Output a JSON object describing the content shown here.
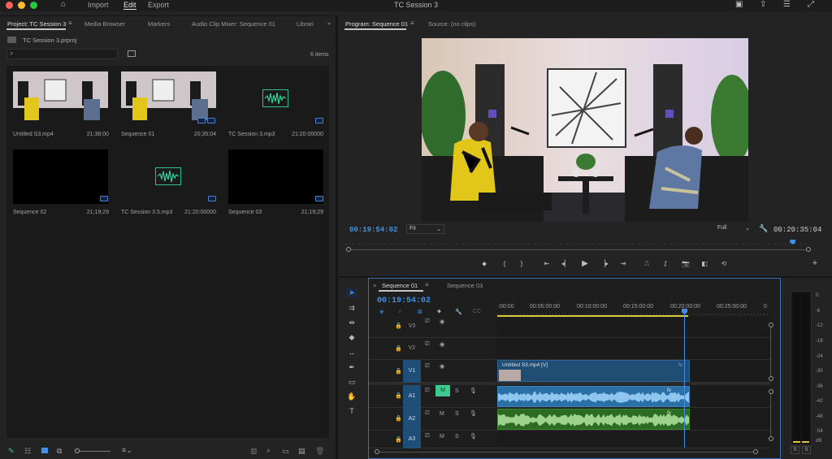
{
  "menubar": {
    "menus": [
      "Import",
      "Edit",
      "Export"
    ],
    "active_menu": "Edit",
    "app_title": "TC Session 3"
  },
  "project_panel": {
    "tabs": [
      "Project: TC Session 3",
      "Media Browser",
      "Markers",
      "Audio Clip Mixer: Sequence 01",
      "Librari"
    ],
    "project_file": "TC Session 3.prproj",
    "search_placeholder": "",
    "item_count": "6 items",
    "items": [
      {
        "name": "Untitled S3.mp4",
        "duration": "21;38;00",
        "kind": "video"
      },
      {
        "name": "Sequence 01",
        "duration": "20;35;04",
        "kind": "sequence-video"
      },
      {
        "name": "TC Session 3.mp3",
        "duration": "21:20:00000",
        "kind": "audio"
      },
      {
        "name": "Sequence 02",
        "duration": "21;19;29",
        "kind": "sequence"
      },
      {
        "name": "TC Session 3.5.mp3",
        "duration": "21:20:00000",
        "kind": "audio"
      },
      {
        "name": "Sequence 03",
        "duration": "21;19;29",
        "kind": "sequence"
      }
    ]
  },
  "program_monitor": {
    "tabs": [
      "Program: Sequence 01",
      "Source: (no clips)"
    ],
    "current_timecode": "00:19:54:02",
    "fit": "Fit",
    "resolution": "Full",
    "duration_timecode": "00:20:35:04",
    "playhead_fraction": 0.967
  },
  "timeline": {
    "tabs": [
      "Sequence 01",
      "Sequence 03"
    ],
    "timecode": "00:19:54:02",
    "ruler_labels": [
      ":00:00",
      "00:05:00:00",
      "00:10:00:00",
      "00:15:00:00",
      "00:20:00:00",
      "00:25:00:00",
      "0"
    ],
    "video_tracks": [
      "V3",
      "V2",
      "V1"
    ],
    "audio_tracks": [
      "A1",
      "A2",
      "A3"
    ],
    "clip_video_label": "Untitled S3.mp4 [V]",
    "mute_label": "M",
    "solo_label": "S"
  },
  "meters": {
    "db_labels": [
      "0",
      "-6",
      "-12",
      "-18",
      "-24",
      "-30",
      "-36",
      "-42",
      "-48",
      "-54",
      "dB"
    ],
    "solo_labels": [
      "S",
      "S"
    ]
  },
  "colors": {
    "accent_blue": "#3f91e6",
    "audio_clip_blue": "#2a6fa6",
    "audio_clip_green": "#2c6b24",
    "video_clip": "#1f4d74",
    "mute_active": "#3ec98e"
  }
}
